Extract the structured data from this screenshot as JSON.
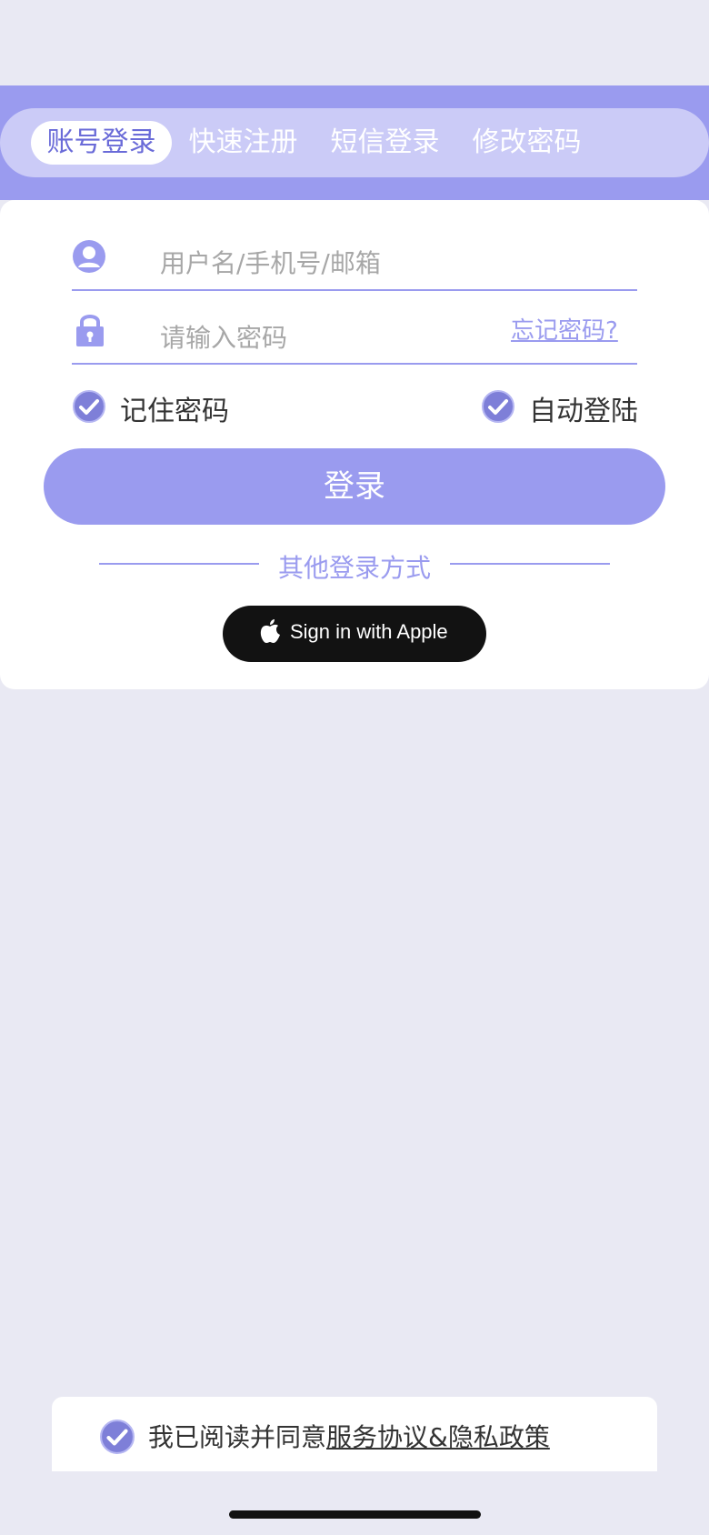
{
  "tabs": [
    {
      "label": "账号登录",
      "active": true
    },
    {
      "label": "快速注册",
      "active": false
    },
    {
      "label": "短信登录",
      "active": false
    },
    {
      "label": "修改密码",
      "active": false
    }
  ],
  "form": {
    "username_placeholder": "用户名/手机号/邮箱",
    "password_placeholder": "请输入密码",
    "forgot_label": "忘记密码?",
    "remember_label": "记住密码",
    "remember_checked": true,
    "auto_login_label": "自动登陆",
    "auto_login_checked": true,
    "login_label": "登录",
    "other_methods_label": "其他登录方式",
    "apple_label": "Sign in with Apple"
  },
  "agreement": {
    "prefix": "我已阅读并同意",
    "link": "服务协议&隐私政策",
    "checked": true
  },
  "colors": {
    "accent": "#9a9bef",
    "accent_light": "#cbcbf7",
    "background": "#e9e9f3",
    "check_fill": "#7e7fd8"
  },
  "icons": {
    "user": "user-icon",
    "lock": "lock-icon",
    "check": "checkmark-icon",
    "apple": "apple-logo-icon"
  }
}
